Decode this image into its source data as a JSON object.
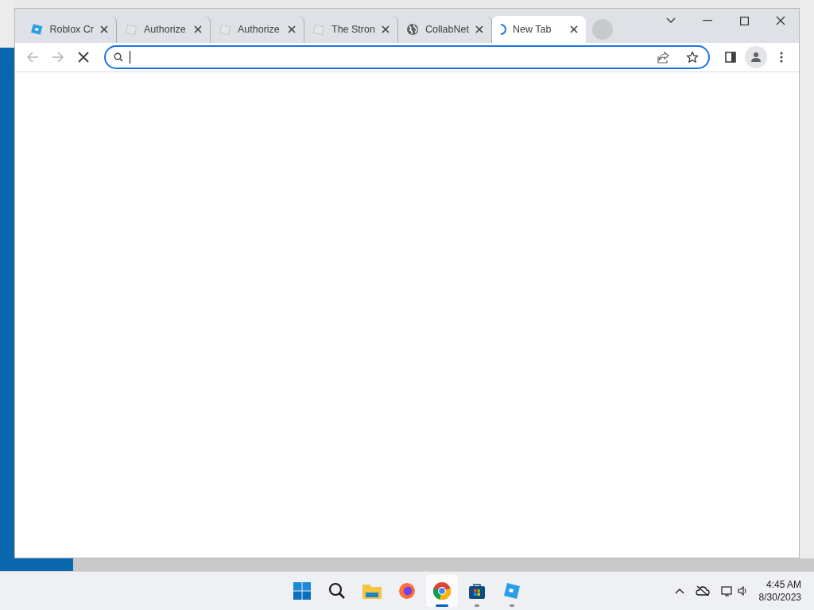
{
  "tabs": [
    {
      "label": "Roblox Cr",
      "kind": "roblox",
      "selected": false
    },
    {
      "label": "Authorize",
      "kind": "page",
      "selected": false
    },
    {
      "label": "Authorize",
      "kind": "page",
      "selected": false
    },
    {
      "label": "The Stron",
      "kind": "page",
      "selected": false
    },
    {
      "label": "CollabNet",
      "kind": "globe",
      "selected": false
    },
    {
      "label": "New Tab",
      "kind": "loading",
      "selected": true
    }
  ],
  "address_bar": {
    "focused": true
  },
  "taskbar": {
    "apps": [
      {
        "kind": "start",
        "running": false,
        "active": false
      },
      {
        "kind": "search",
        "running": false,
        "active": false
      },
      {
        "kind": "files",
        "running": false,
        "active": false
      },
      {
        "kind": "firefox",
        "running": false,
        "active": false
      },
      {
        "kind": "chrome",
        "running": true,
        "active": true
      },
      {
        "kind": "store",
        "running": true,
        "active": false
      },
      {
        "kind": "roblox",
        "running": true,
        "active": false
      }
    ],
    "time": "4:45 AM",
    "date": "8/30/2023"
  }
}
